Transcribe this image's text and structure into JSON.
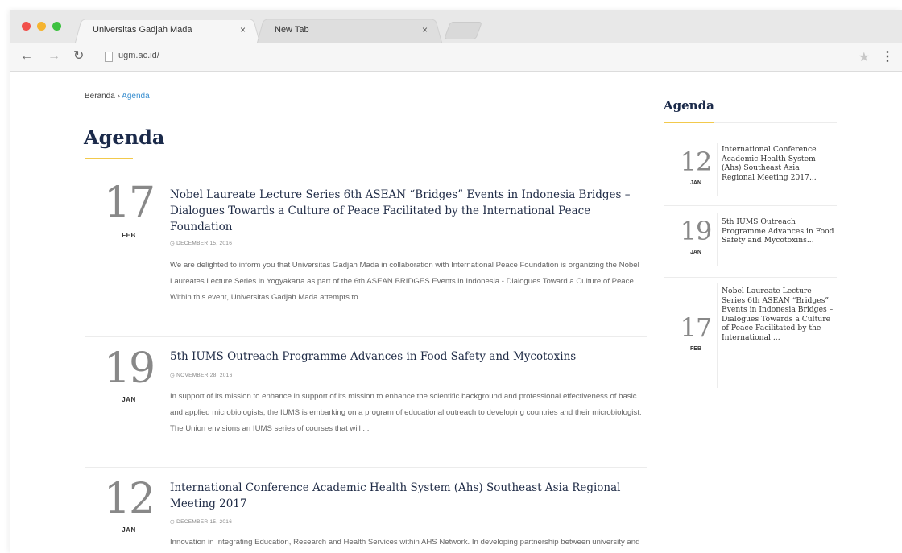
{
  "browser": {
    "tabs": [
      {
        "title": "Universitas Gadjah Mada",
        "close": "×"
      },
      {
        "title": "New Tab",
        "close": "×"
      }
    ],
    "url": "ugm.ac.id/"
  },
  "breadcrumb": {
    "home": "Beranda",
    "separator": " › ",
    "current": "Agenda"
  },
  "main": {
    "title": "Agenda",
    "items": [
      {
        "day": "17",
        "month": "FEB",
        "title": "Nobel Laureate Lecture Series 6th ASEAN “Bridges” Events in Indonesia Bridges – Dialogues Towards a Culture of Peace Facilitated by the International Peace Foundation",
        "date": "DECEMBER 15, 2016",
        "excerpt": "We are delighted to inform you that Universitas Gadjah Mada in collaboration with International Peace Foundation is organizing the Nobel Laureates Lecture Series in Yogyakarta as part of the 6th ASEAN BRIDGES Events in Indonesia - Dialogues Toward a Culture of Peace. Within this event, Universitas Gadjah Mada attempts to ..."
      },
      {
        "day": "19",
        "month": "JAN",
        "title": "5th IUMS Outreach Programme Advances in Food Safety and Mycotoxins",
        "date": "NOVEMBER 28, 2016",
        "excerpt": "In support of its mission to enhance in support of its mission to enhance the scientific background and professional effectiveness of basic and applied microbiologists, the IUMS is embarking on a program of educational outreach to developing countries and their microbiologist. The Union envisions an IUMS series of courses that will ..."
      },
      {
        "day": "12",
        "month": "JAN",
        "title": "International Conference Academic Health System (Ahs) Southeast Asia Regional Meeting 2017",
        "date": "DECEMBER 15, 2016",
        "excerpt": "Innovation in Integrating Education, Research and Health Services within AHS Network. In developing partnership between university and other health care system which focusing in research, patients care,"
      }
    ]
  },
  "sidebar": {
    "title": "Agenda",
    "items": [
      {
        "day": "12",
        "month": "JAN",
        "text": "International Conference Academic Health System (Ahs) Southeast Asia Regional Meeting 2017..."
      },
      {
        "day": "19",
        "month": "JAN",
        "text": "5th IUMS Outreach Programme Advances in Food Safety and Mycotoxins..."
      },
      {
        "day": "17",
        "month": "FEB",
        "text": "Nobel Laureate Lecture Series 6th ASEAN “Bridges” Events in Indonesia Bridges – Dialogues Towards a Culture of Peace Facilitated by the International ..."
      }
    ]
  },
  "colors": {
    "accent": "#f2c94c",
    "heading": "#1b2a4a",
    "link": "#3a8fd0"
  },
  "icons": [
    "back-icon",
    "forward-icon",
    "reload-icon",
    "page-icon",
    "star-icon",
    "menu-icon",
    "clock-icon"
  ]
}
